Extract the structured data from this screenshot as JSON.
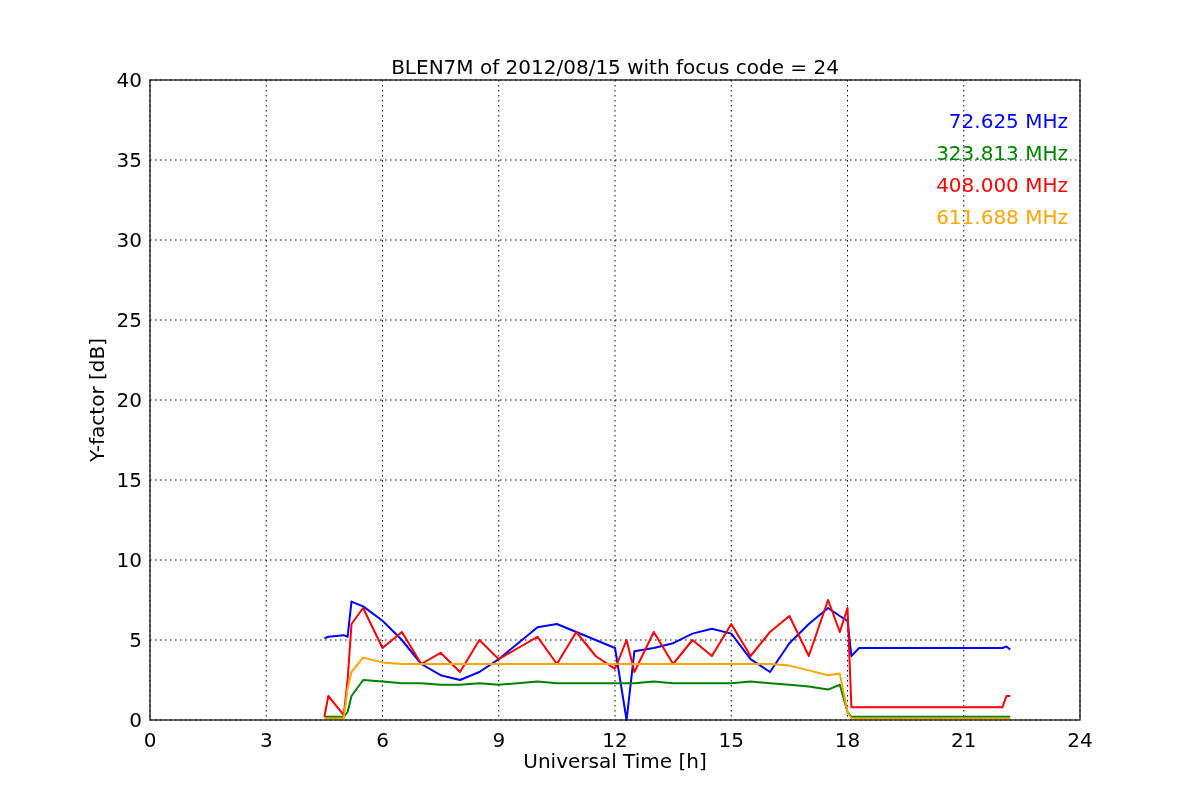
{
  "chart_data": {
    "type": "line",
    "title": "BLEN7M of 2012/08/15 with focus code = 24",
    "xlabel": "Universal Time [h]",
    "ylabel": "Y-factor [dB]",
    "x": [
      4.5,
      4.6,
      5.0,
      5.1,
      5.2,
      5.5,
      6,
      6.5,
      7,
      7.5,
      8,
      8.5,
      9,
      9.5,
      10,
      10.5,
      11,
      11.5,
      12,
      12.3,
      12.5,
      13,
      13.5,
      14,
      14.5,
      15,
      15.5,
      16,
      16.5,
      17,
      17.5,
      17.8,
      18,
      18.1,
      18.3,
      20,
      22,
      22.1,
      22.2
    ],
    "series": [
      {
        "name": "72.625 MHz",
        "color": "#0000ff",
        "values": [
          5.1,
          5.2,
          5.3,
          5.2,
          7.4,
          7.1,
          6.2,
          5.0,
          3.5,
          2.8,
          2.5,
          3.0,
          3.8,
          4.8,
          5.8,
          6.0,
          5.5,
          5.0,
          4.5,
          0.0,
          4.3,
          4.5,
          4.8,
          5.4,
          5.7,
          5.4,
          3.8,
          3.0,
          4.8,
          6.0,
          7.0,
          6.5,
          6.2,
          4.0,
          4.5,
          4.5,
          4.5,
          4.6,
          4.4
        ]
      },
      {
        "name": "323.813 MHz",
        "color": "#008000",
        "values": [
          0.2,
          0.2,
          0.2,
          0.5,
          1.5,
          2.5,
          2.4,
          2.3,
          2.3,
          2.2,
          2.2,
          2.3,
          2.2,
          2.3,
          2.4,
          2.3,
          2.3,
          2.3,
          2.3,
          2.3,
          2.3,
          2.4,
          2.3,
          2.3,
          2.3,
          2.3,
          2.4,
          2.3,
          2.2,
          2.1,
          1.9,
          2.2,
          0.5,
          0.2,
          0.2,
          0.2,
          0.2,
          0.2,
          0.2
        ]
      },
      {
        "name": "408.000 MHz",
        "color": "#ff0000",
        "values": [
          0.2,
          1.5,
          0.3,
          2.5,
          6.0,
          7.0,
          4.5,
          5.5,
          3.5,
          4.2,
          3.0,
          5.0,
          3.8,
          4.5,
          5.2,
          3.5,
          5.5,
          4.0,
          3.2,
          5.0,
          3.0,
          5.5,
          3.5,
          5.0,
          4.0,
          6.0,
          4.0,
          5.5,
          6.5,
          4.0,
          7.5,
          5.5,
          7.0,
          0.8,
          0.8,
          0.8,
          0.8,
          1.5,
          1.5
        ]
      },
      {
        "name": "611.688 MHz",
        "color": "#ffa500",
        "values": [
          0.1,
          0.1,
          0.1,
          2.0,
          3.0,
          3.9,
          3.6,
          3.5,
          3.5,
          3.5,
          3.5,
          3.5,
          3.5,
          3.5,
          3.5,
          3.5,
          3.5,
          3.5,
          3.5,
          3.5,
          3.5,
          3.5,
          3.5,
          3.5,
          3.5,
          3.5,
          3.5,
          3.5,
          3.4,
          3.1,
          2.8,
          2.9,
          0.5,
          0.1,
          0.1,
          0.1,
          0.1,
          0.1,
          0.1
        ]
      }
    ],
    "xlim": [
      0,
      24
    ],
    "ylim": [
      0,
      40
    ],
    "xticks": [
      0,
      3,
      6,
      9,
      12,
      15,
      18,
      21,
      24
    ],
    "yticks": [
      0,
      5,
      10,
      15,
      20,
      25,
      30,
      35,
      40
    ],
    "grid": true
  }
}
